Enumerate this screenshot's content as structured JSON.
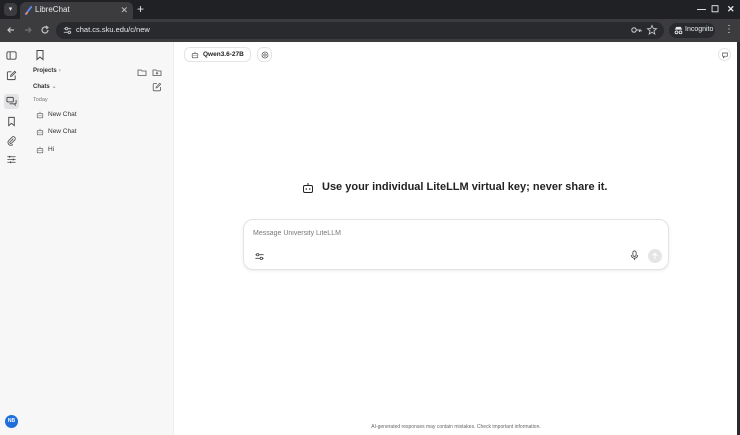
{
  "browser": {
    "tab_title": "LibreChat",
    "url": "chat.cs.sku.edu/c/new",
    "incognito_label": "Incognito",
    "tab_close_glyph": "✕",
    "new_tab_glyph": "+",
    "minimize_glyph": "—",
    "maximize_glyph": "☐",
    "close_glyph": "✕",
    "menu_glyph": "⋮",
    "tab_menu_glyph": "▾"
  },
  "sidebar": {
    "projects_label": "Projects",
    "chats_label": "Chats",
    "today_label": "Today",
    "chats": [
      {
        "title": "New Chat"
      },
      {
        "title": "New Chat"
      },
      {
        "title": "Hi"
      }
    ]
  },
  "user": {
    "initials": "NB"
  },
  "main": {
    "model_name": "Qwen3.6-27B",
    "hero_text": "Use your individual LiteLLM virtual key; never share it.",
    "composer_placeholder": "Message University LiteLLM",
    "footer_text": "AI-generated responses may contain mistakes. Check important information."
  },
  "icons": [
    "sidebar-toggle-icon",
    "new-chat-icon",
    "chats-icon",
    "bookmark-icon",
    "attachment-icon",
    "settings-sliders-icon",
    "bot-icon",
    "mic-icon",
    "send-arrow-icon",
    "tools-icon",
    "key-icon",
    "star-icon"
  ],
  "colors": {
    "chrome_dark": "#202124",
    "chrome_bar": "#3c3c3f",
    "avatar": "#1e6fd9",
    "sidebar_bg": "#f7f7f8"
  }
}
